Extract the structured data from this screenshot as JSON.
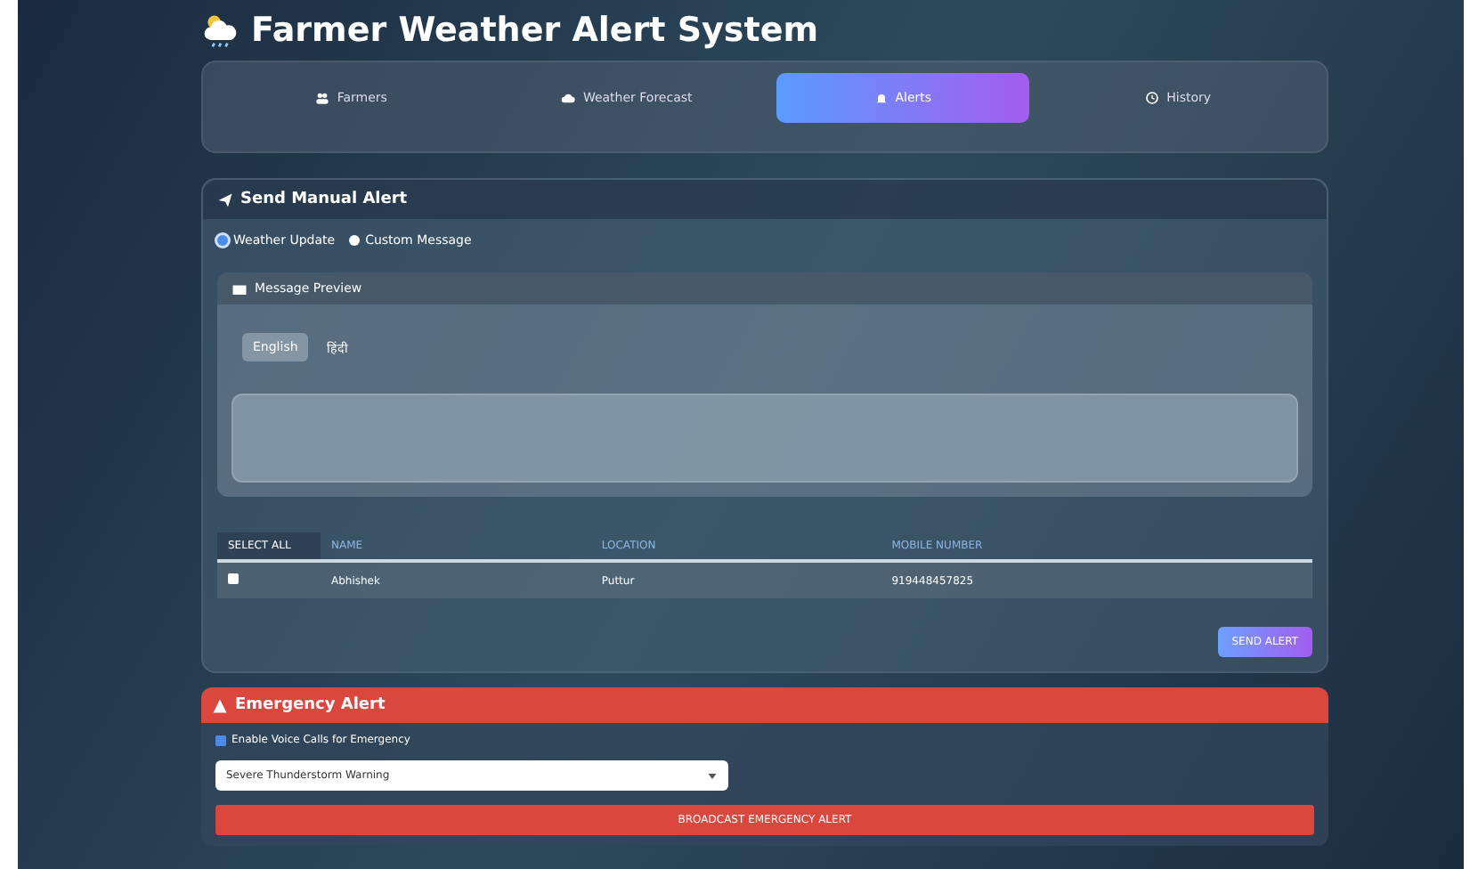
{
  "app": {
    "title": "Farmer Weather Alert System"
  },
  "tabs": [
    {
      "label": "Farmers",
      "selected": false
    },
    {
      "label": "Weather Forecast",
      "selected": false
    },
    {
      "label": "Alerts",
      "selected": true
    },
    {
      "label": "History",
      "selected": false
    }
  ],
  "manual_alert": {
    "title": "Send Manual Alert",
    "options": [
      {
        "label": "Weather Update",
        "selected": true
      },
      {
        "label": "Custom Message",
        "selected": false
      }
    ],
    "preview": {
      "title": "Message Preview",
      "languages": [
        {
          "label": "English",
          "selected": true
        },
        {
          "label": "हिंदी",
          "selected": false
        }
      ]
    },
    "table": {
      "columns": [
        "SELECT ALL",
        "NAME",
        "LOCATION",
        "MOBILE NUMBER"
      ],
      "rows": [
        {
          "checked": false,
          "name": "Abhishek",
          "location": "Puttur",
          "mobile_number": "919448457825"
        }
      ]
    },
    "send_button": "SEND ALERT"
  },
  "emergency": {
    "title": "Emergency Alert",
    "voice_calls": {
      "label": "Enable Voice Calls for Emergency",
      "checked": true
    },
    "select": "Severe Thunderstorm Warning",
    "button": "BROADCAST EMERGENCY ALERT"
  }
}
